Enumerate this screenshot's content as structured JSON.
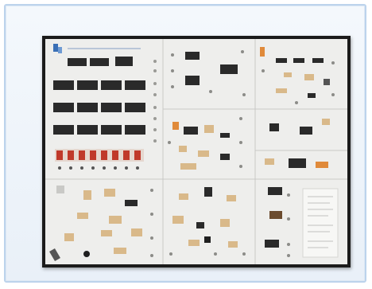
{
  "image": {
    "subject": "electronics-trainer-board-photo",
    "colors": {
      "card_border": "#bcd3ec",
      "card_bg": "#edf3fa",
      "frame": "#1b1b1b",
      "panel": "#eeeeec",
      "chip": "#2a2a2a",
      "component_tan": "#d9b98a",
      "terminal_red": "#c0392b",
      "accent_orange": "#e08a3a"
    }
  }
}
